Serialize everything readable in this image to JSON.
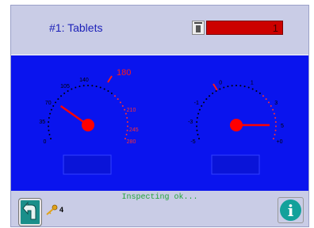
{
  "header": {
    "title": "#1: Tablets",
    "counter_value": "1"
  },
  "gauges": {
    "left": {
      "tick_labels": [
        "0",
        "35",
        "70",
        "105",
        "140",
        "210",
        "245",
        "280"
      ],
      "highlight_label": "180",
      "value": 70
    },
    "right": {
      "tick_labels": [
        "-5",
        "-3",
        "-1",
        "0",
        "1",
        "3",
        "5",
        "+0"
      ],
      "value": 5
    }
  },
  "footer": {
    "key_count": "4",
    "status_text": "Inspecting ok...",
    "info_label": "i"
  },
  "icons": {
    "trash": "trash-icon",
    "back": "back-arrow-icon",
    "key": "key-icon",
    "info": "info-icon"
  },
  "colors": {
    "panel": "#0a14ee",
    "frame": "#c9cce6",
    "needle": "#ff0000",
    "counter": "#cc0000",
    "status": "#22a43a"
  }
}
